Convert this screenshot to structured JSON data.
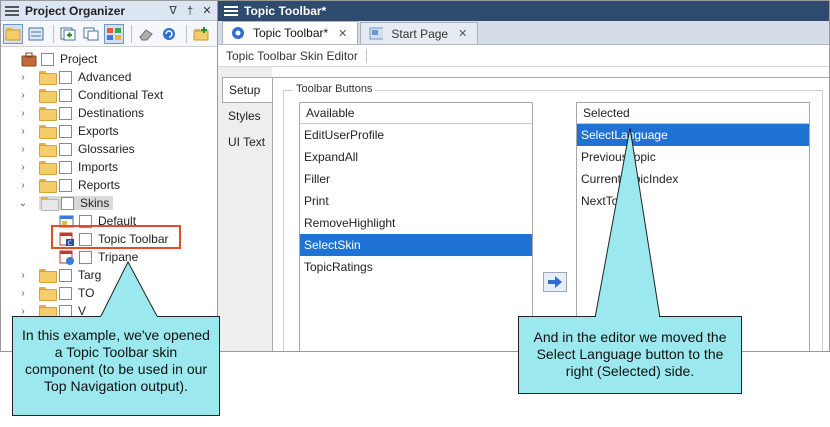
{
  "project_organizer": {
    "title": "Project Organizer",
    "pin": "∇",
    "pin2": "†",
    "close": "✕",
    "tree": {
      "root": "Project",
      "items": [
        {
          "label": "Advanced",
          "expander": "›"
        },
        {
          "label": "Conditional Text",
          "expander": "›"
        },
        {
          "label": "Destinations",
          "expander": "›"
        },
        {
          "label": "Exports",
          "expander": "›"
        },
        {
          "label": "Glossaries",
          "expander": "›"
        },
        {
          "label": "Imports",
          "expander": "›"
        },
        {
          "label": "Reports",
          "expander": "›"
        },
        {
          "label": "Skins",
          "expander": "⌄"
        }
      ],
      "skins": [
        {
          "label": "Default"
        },
        {
          "label": "Topic Toolbar"
        },
        {
          "label": "Tripane"
        }
      ],
      "after": [
        {
          "label": "Targ",
          "expander": "›"
        },
        {
          "label": "TO",
          "expander": "›"
        },
        {
          "label": "V",
          "expander": "›"
        }
      ]
    }
  },
  "editor": {
    "title": "Topic Toolbar*",
    "tabs": [
      {
        "label": "Topic Toolbar*",
        "close": "✕"
      },
      {
        "label": "Start Page",
        "close": "✕"
      }
    ],
    "subtitle": "Topic Toolbar Skin Editor",
    "side_tabs": [
      "Setup",
      "Styles",
      "UI Text"
    ],
    "group_label": "Toolbar Buttons",
    "available": {
      "header": "Available",
      "items": [
        "EditUserProfile",
        "ExpandAll",
        "Filler",
        "Print",
        "RemoveHighlight",
        "SelectSkin",
        "TopicRatings"
      ],
      "selected_index": 5
    },
    "selected": {
      "header": "Selected",
      "items": [
        "SelectLanguage",
        "PreviousTopic",
        "CurrentTopicIndex",
        "NextTopic"
      ],
      "selected_index": 0
    }
  },
  "callouts": {
    "left": "In this example, we've opened a Topic Toolbar skin component (to be used in our Top Navigation output).",
    "right": "And in the editor we moved the Select Language button to the right (Selected) side."
  },
  "colors": {
    "callout_fill": "#9be9ee",
    "highlight_box": "#e04e2a",
    "selection": "#1f73d4",
    "editor_title": "#2e4a6e"
  }
}
